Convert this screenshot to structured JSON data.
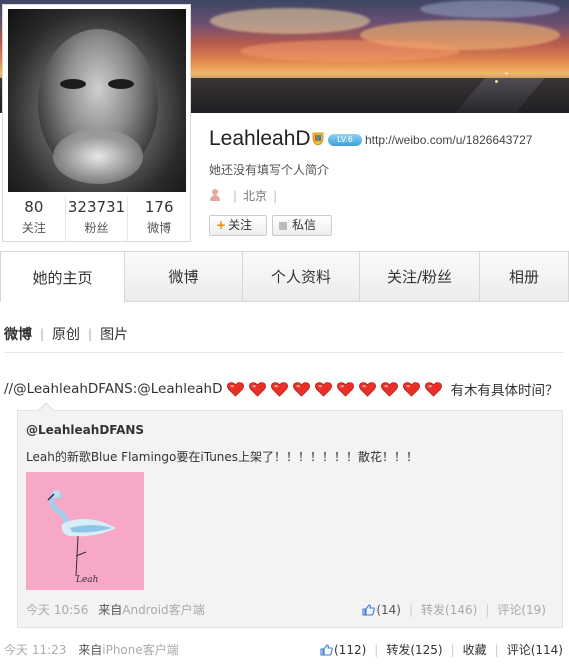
{
  "profile": {
    "name": "LeahleahD",
    "level": "LV.6",
    "url": "http://weibo.com/u/1826643727",
    "bio": "她还没有填写个人简介",
    "location": "北京",
    "follow_btn": "关注",
    "message_btn": "私信"
  },
  "stats": [
    {
      "value": "80",
      "label": "关注"
    },
    {
      "value": "323731",
      "label": "粉丝"
    },
    {
      "value": "176",
      "label": "微博"
    }
  ],
  "tabs": [
    "她的主页",
    "微博",
    "个人资料",
    "关注/粉丝",
    "相册"
  ],
  "subtabs": [
    "微博",
    "原创",
    "图片"
  ],
  "post": {
    "prefix": "//@LeahleahDFANS:@LeahleahD",
    "hearts": 10,
    "suffix": "有木有具体时间？",
    "time": "今天 11:23",
    "source_prefix": "来自",
    "source": "iPhone客户端",
    "actions": {
      "likes": "(112)",
      "repost": "转发(125)",
      "favorite": "收藏",
      "comment": "评论(114)"
    }
  },
  "repost": {
    "author": "@LeahleahDFANS",
    "text": "Leah的新歌Blue Flamingo要在iTunes上架了！！！！！！！散花！！！",
    "image_signature": "Leah",
    "time": "今天 10:56",
    "source_prefix": "来自",
    "source": "Android客户端",
    "actions": {
      "likes": "(14)",
      "repost": "转发(146)",
      "comment": "评论(19)"
    }
  },
  "colors": {
    "heart": "#e8302a",
    "thumbnail_bg": "#f7a8c7",
    "link_gray": "#aaaaaa",
    "like_blue": "#3b7bd4"
  }
}
